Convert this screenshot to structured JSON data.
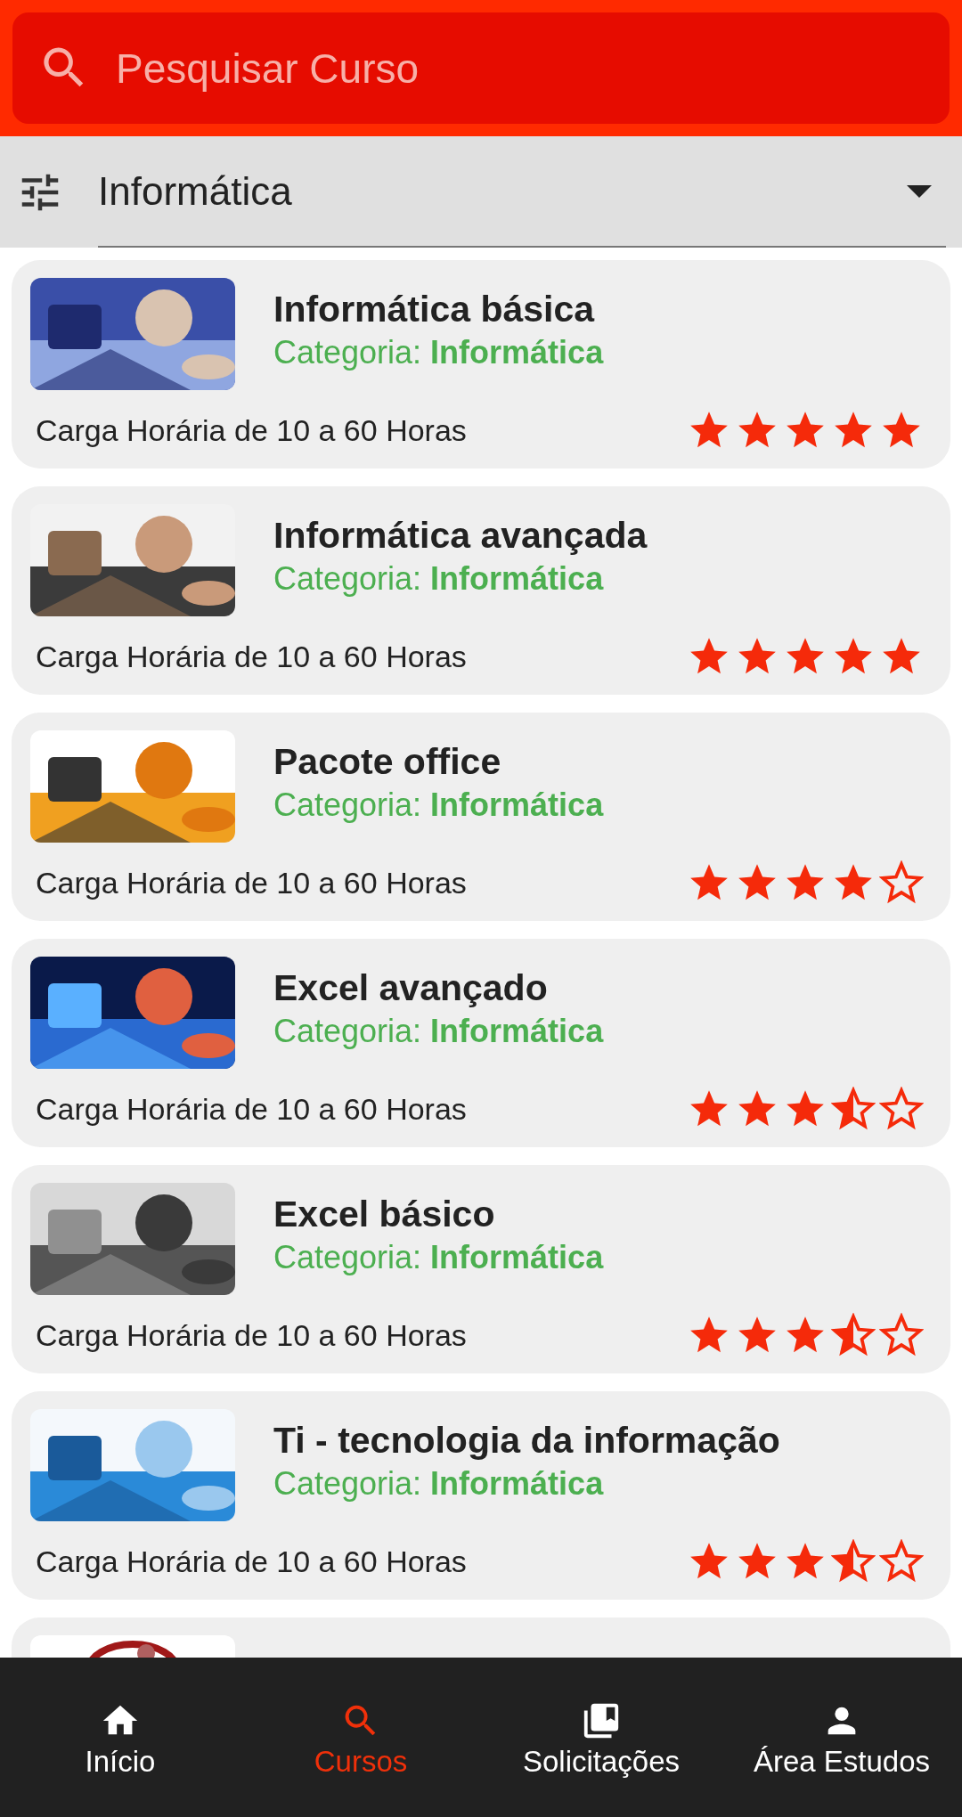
{
  "search": {
    "placeholder": "Pesquisar Curso"
  },
  "filter": {
    "value": "Informática"
  },
  "courses": [
    {
      "title": "Informática básica",
      "category": "Categoria: **Informática**",
      "hours": "Carga Horária de 10 a 60 Horas",
      "stars": 5
    },
    {
      "title": "Informática avançada",
      "category": "Categoria: **Informática**",
      "hours": "Carga Horária de 10 a 60 Horas",
      "stars": 5
    },
    {
      "title": "Pacote office",
      "category": "Categoria: **Informática**",
      "hours": "Carga Horária de 10 a 60 Horas",
      "stars": 4
    },
    {
      "title": "Excel avançado",
      "category": "Categoria: **Informática**",
      "hours": "Carga Horária de 10 a 60 Horas",
      "stars": 3.5
    },
    {
      "title": "Excel básico",
      "category": "Categoria: **Informática**",
      "hours": "Carga Horária de 10 a 60 Horas",
      "stars": 3.5
    },
    {
      "title": "Ti - tecnologia da informação",
      "category": "Categoria: **Informática**",
      "hours": "Carga Horária de 10 a 60 Horas",
      "stars": 3.5
    }
  ],
  "nav": [
    {
      "label": "Início",
      "kind": "home",
      "selected": false
    },
    {
      "label": "Cursos",
      "kind": "search",
      "selected": true
    },
    {
      "label": "Solicitações",
      "kind": "library",
      "selected": false
    },
    {
      "label": "Área Estudos",
      "kind": "person",
      "selected": false
    }
  ]
}
